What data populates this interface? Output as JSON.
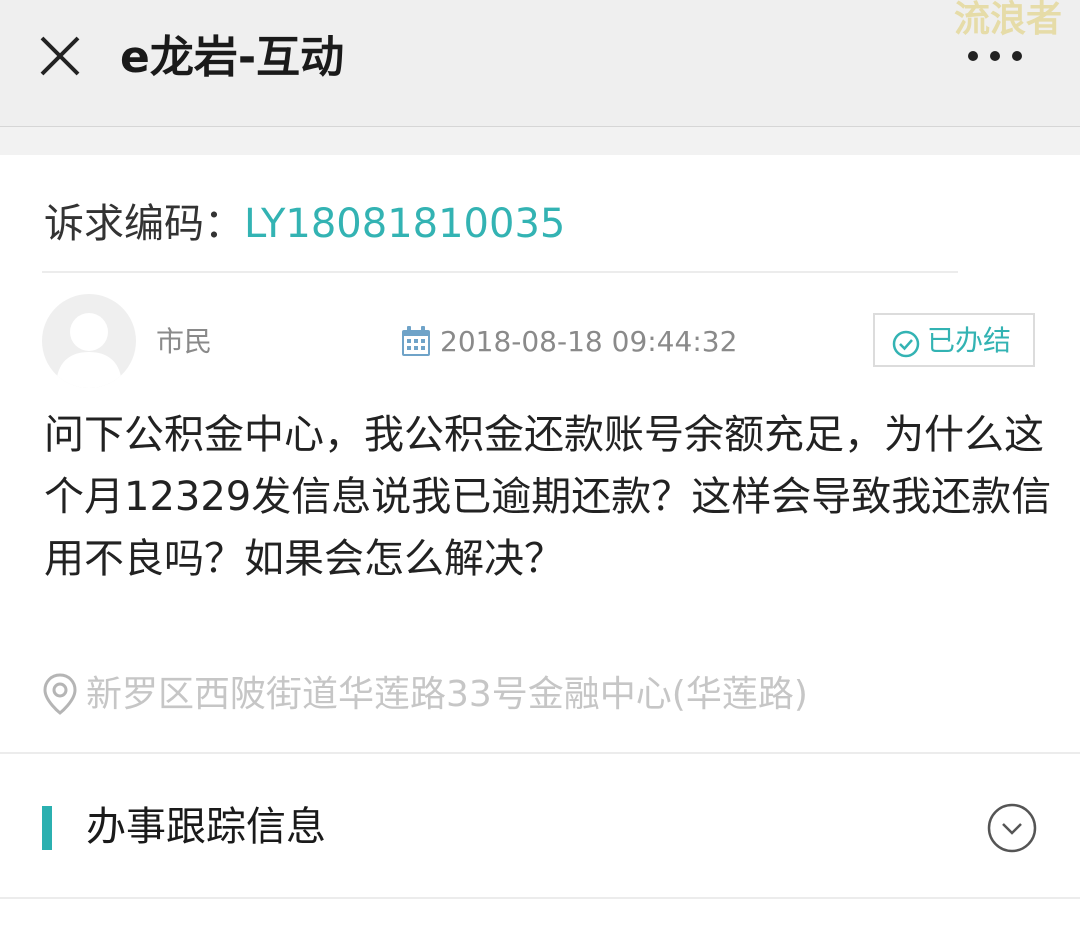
{
  "header": {
    "title": "e龙岩-互动",
    "close_icon": "close-icon",
    "more_icon": "more-dots-icon"
  },
  "watermark": "流浪者",
  "petition": {
    "code_label": "诉求编码：",
    "code_value": "LY18081810035",
    "user_name": "市民",
    "timestamp": "2018-08-18 09:44:32",
    "status": "已办结",
    "question": "问下公积金中心，我公积金还款账号余额充足，为什么这个月12329发信息说我已逾期还款？这样会导致我还款信用不良吗？如果会怎么解决？",
    "location": "新罗区西陂街道华莲路33号金融中心(华莲路)"
  },
  "tracking": {
    "title": "办事跟踪信息",
    "expand_icon": "chevron-down-icon"
  },
  "colors": {
    "accent": "#33b3b3",
    "header_bg": "#efefef",
    "muted_text": "#8a8a8a",
    "location_text": "#c6c6c6"
  }
}
